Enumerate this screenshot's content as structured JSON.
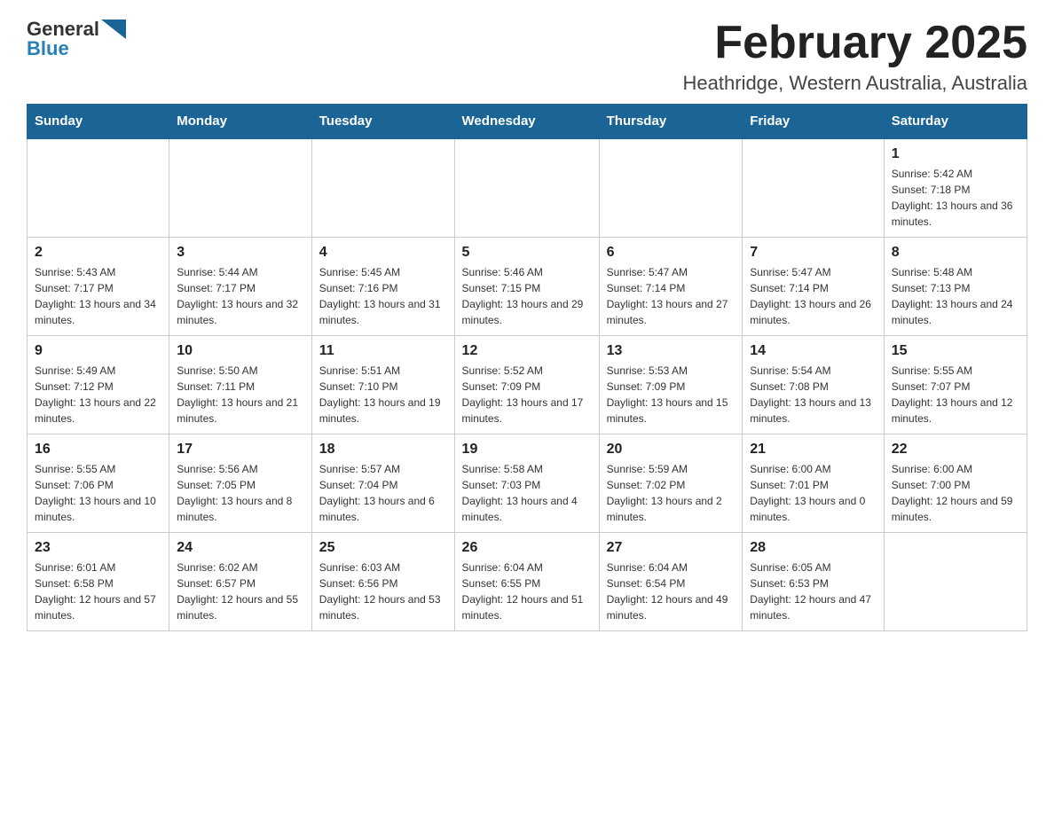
{
  "header": {
    "logo": {
      "general": "General",
      "blue": "Blue"
    },
    "title": "February 2025",
    "location": "Heathridge, Western Australia, Australia"
  },
  "weekdays": [
    "Sunday",
    "Monday",
    "Tuesday",
    "Wednesday",
    "Thursday",
    "Friday",
    "Saturday"
  ],
  "weeks": [
    [
      {
        "day": "",
        "info": ""
      },
      {
        "day": "",
        "info": ""
      },
      {
        "day": "",
        "info": ""
      },
      {
        "day": "",
        "info": ""
      },
      {
        "day": "",
        "info": ""
      },
      {
        "day": "",
        "info": ""
      },
      {
        "day": "1",
        "info": "Sunrise: 5:42 AM\nSunset: 7:18 PM\nDaylight: 13 hours and 36 minutes."
      }
    ],
    [
      {
        "day": "2",
        "info": "Sunrise: 5:43 AM\nSunset: 7:17 PM\nDaylight: 13 hours and 34 minutes."
      },
      {
        "day": "3",
        "info": "Sunrise: 5:44 AM\nSunset: 7:17 PM\nDaylight: 13 hours and 32 minutes."
      },
      {
        "day": "4",
        "info": "Sunrise: 5:45 AM\nSunset: 7:16 PM\nDaylight: 13 hours and 31 minutes."
      },
      {
        "day": "5",
        "info": "Sunrise: 5:46 AM\nSunset: 7:15 PM\nDaylight: 13 hours and 29 minutes."
      },
      {
        "day": "6",
        "info": "Sunrise: 5:47 AM\nSunset: 7:14 PM\nDaylight: 13 hours and 27 minutes."
      },
      {
        "day": "7",
        "info": "Sunrise: 5:47 AM\nSunset: 7:14 PM\nDaylight: 13 hours and 26 minutes."
      },
      {
        "day": "8",
        "info": "Sunrise: 5:48 AM\nSunset: 7:13 PM\nDaylight: 13 hours and 24 minutes."
      }
    ],
    [
      {
        "day": "9",
        "info": "Sunrise: 5:49 AM\nSunset: 7:12 PM\nDaylight: 13 hours and 22 minutes."
      },
      {
        "day": "10",
        "info": "Sunrise: 5:50 AM\nSunset: 7:11 PM\nDaylight: 13 hours and 21 minutes."
      },
      {
        "day": "11",
        "info": "Sunrise: 5:51 AM\nSunset: 7:10 PM\nDaylight: 13 hours and 19 minutes."
      },
      {
        "day": "12",
        "info": "Sunrise: 5:52 AM\nSunset: 7:09 PM\nDaylight: 13 hours and 17 minutes."
      },
      {
        "day": "13",
        "info": "Sunrise: 5:53 AM\nSunset: 7:09 PM\nDaylight: 13 hours and 15 minutes."
      },
      {
        "day": "14",
        "info": "Sunrise: 5:54 AM\nSunset: 7:08 PM\nDaylight: 13 hours and 13 minutes."
      },
      {
        "day": "15",
        "info": "Sunrise: 5:55 AM\nSunset: 7:07 PM\nDaylight: 13 hours and 12 minutes."
      }
    ],
    [
      {
        "day": "16",
        "info": "Sunrise: 5:55 AM\nSunset: 7:06 PM\nDaylight: 13 hours and 10 minutes."
      },
      {
        "day": "17",
        "info": "Sunrise: 5:56 AM\nSunset: 7:05 PM\nDaylight: 13 hours and 8 minutes."
      },
      {
        "day": "18",
        "info": "Sunrise: 5:57 AM\nSunset: 7:04 PM\nDaylight: 13 hours and 6 minutes."
      },
      {
        "day": "19",
        "info": "Sunrise: 5:58 AM\nSunset: 7:03 PM\nDaylight: 13 hours and 4 minutes."
      },
      {
        "day": "20",
        "info": "Sunrise: 5:59 AM\nSunset: 7:02 PM\nDaylight: 13 hours and 2 minutes."
      },
      {
        "day": "21",
        "info": "Sunrise: 6:00 AM\nSunset: 7:01 PM\nDaylight: 13 hours and 0 minutes."
      },
      {
        "day": "22",
        "info": "Sunrise: 6:00 AM\nSunset: 7:00 PM\nDaylight: 12 hours and 59 minutes."
      }
    ],
    [
      {
        "day": "23",
        "info": "Sunrise: 6:01 AM\nSunset: 6:58 PM\nDaylight: 12 hours and 57 minutes."
      },
      {
        "day": "24",
        "info": "Sunrise: 6:02 AM\nSunset: 6:57 PM\nDaylight: 12 hours and 55 minutes."
      },
      {
        "day": "25",
        "info": "Sunrise: 6:03 AM\nSunset: 6:56 PM\nDaylight: 12 hours and 53 minutes."
      },
      {
        "day": "26",
        "info": "Sunrise: 6:04 AM\nSunset: 6:55 PM\nDaylight: 12 hours and 51 minutes."
      },
      {
        "day": "27",
        "info": "Sunrise: 6:04 AM\nSunset: 6:54 PM\nDaylight: 12 hours and 49 minutes."
      },
      {
        "day": "28",
        "info": "Sunrise: 6:05 AM\nSunset: 6:53 PM\nDaylight: 12 hours and 47 minutes."
      },
      {
        "day": "",
        "info": ""
      }
    ]
  ]
}
